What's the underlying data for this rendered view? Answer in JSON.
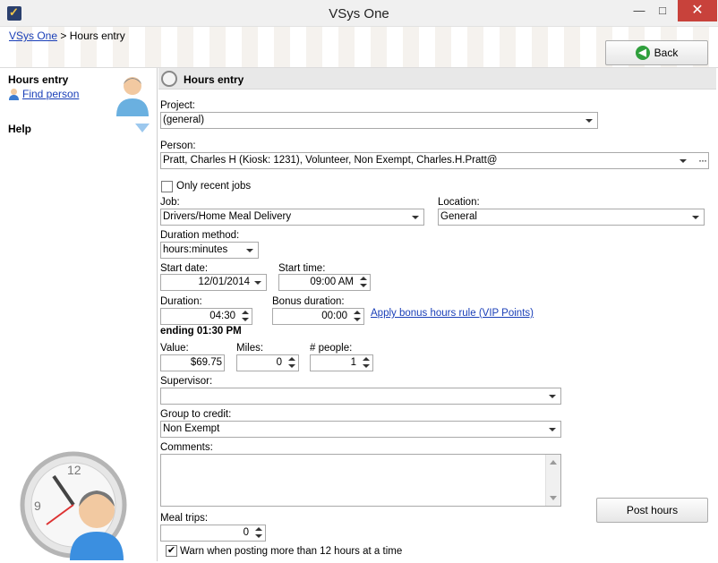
{
  "window": {
    "title": "VSys One",
    "minimize": "—",
    "maximize": "□",
    "close": "✕"
  },
  "breadcrumb": {
    "home": "VSys One",
    "separator": ">",
    "current": "Hours entry"
  },
  "header": {
    "back_label": "Back"
  },
  "left_panel": {
    "title": "Hours entry",
    "find_person": "Find person",
    "help": "Help"
  },
  "section": {
    "title": "Hours entry"
  },
  "form": {
    "project_label": "Project:",
    "project_value": "(general)",
    "person_label": "Person:",
    "person_value": "Pratt, Charles H (Kiosk: 1231), Volunteer, Non Exempt, Charles.H.Pratt@",
    "person_more": "···",
    "only_recent_label": "Only recent jobs",
    "only_recent_checked": false,
    "job_label": "Job:",
    "job_value": "Drivers/Home Meal Delivery",
    "location_label": "Location:",
    "location_value": "General",
    "duration_method_label": "Duration method:",
    "duration_method_value": "hours:minutes",
    "start_date_label": "Start date:",
    "start_date_value": "12/01/2014",
    "start_time_label": "Start time:",
    "start_time_value": "09:00 AM",
    "duration_label": "Duration:",
    "duration_value": "04:30",
    "bonus_duration_label": "Bonus duration:",
    "bonus_duration_value": "00:00",
    "bonus_rule_link": "Apply bonus hours rule (VIP Points)",
    "ending_text": "ending 01:30 PM",
    "value_label": "Value:",
    "value_value": "$69.75",
    "miles_label": "Miles:",
    "miles_value": "0",
    "people_label": "# people:",
    "people_value": "1",
    "supervisor_label": "Supervisor:",
    "supervisor_value": "",
    "group_label": "Group to credit:",
    "group_value": "Non Exempt",
    "comments_label": "Comments:",
    "comments_value": "",
    "meal_trips_label": "Meal trips:",
    "meal_trips_value": "0",
    "warn_label": "Warn when posting more than 12 hours at a time",
    "warn_checked": true,
    "warn_check_glyph": "✔",
    "post_label": "Post hours"
  }
}
